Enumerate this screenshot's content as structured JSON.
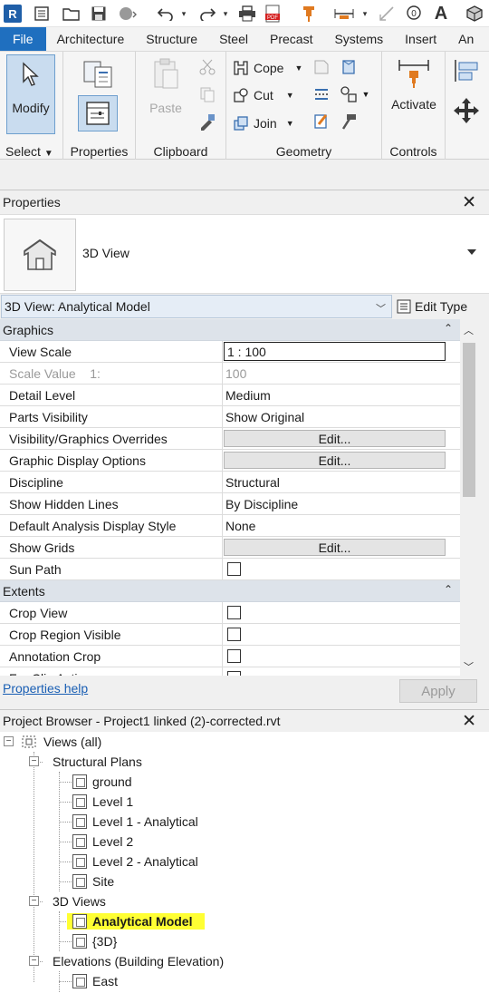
{
  "qat": {
    "icons": [
      "revit-logo",
      "open-icon",
      "save-icon",
      "sync-icon",
      "undo-icon",
      "redo-icon",
      "print-icon",
      "pdf-icon",
      "pin-icon",
      "measure-icon",
      "dimension-icon",
      "tag-icon",
      "text-icon",
      "3d-view-icon"
    ],
    "logo_letter": "R"
  },
  "tabs": [
    "File",
    "Architecture",
    "Structure",
    "Steel",
    "Precast",
    "Systems",
    "Insert",
    "An"
  ],
  "ribbon": {
    "modify_label": "Modify",
    "select_label": "Select",
    "properties_label": "Properties",
    "clipboard_label": "Clipboard",
    "paste_label": "Paste",
    "cope_label": "Cope",
    "cut_label": "Cut",
    "join_label": "Join",
    "geometry_label": "Geometry",
    "activate_label": "Activate",
    "controls_label": "Controls"
  },
  "properties": {
    "title": "Properties",
    "type_name": "3D View",
    "instance_selector": "3D View: Analytical Model",
    "edit_type": "Edit Type",
    "groups": {
      "graphics": "Graphics",
      "extents": "Extents"
    },
    "rows": {
      "view_scale": {
        "key": "View Scale",
        "value": "1 : 100"
      },
      "scale_value": {
        "key": "Scale Value    1:",
        "value": "100"
      },
      "detail_level": {
        "key": "Detail Level",
        "value": "Medium"
      },
      "parts_visibility": {
        "key": "Parts Visibility",
        "value": "Show Original"
      },
      "vg_overrides": {
        "key": "Visibility/Graphics Overrides",
        "value": "Edit..."
      },
      "graphic_display": {
        "key": "Graphic Display Options",
        "value": "Edit..."
      },
      "discipline": {
        "key": "Discipline",
        "value": "Structural"
      },
      "hidden_lines": {
        "key": "Show Hidden Lines",
        "value": "By Discipline"
      },
      "analysis_style": {
        "key": "Default Analysis Display Style",
        "value": "None"
      },
      "show_grids": {
        "key": "Show Grids",
        "value": "Edit..."
      },
      "sun_path": {
        "key": "Sun Path",
        "checked": false
      },
      "crop_view": {
        "key": "Crop View",
        "checked": false
      },
      "crop_region": {
        "key": "Crop Region Visible",
        "checked": false
      },
      "annotation_crop": {
        "key": "Annotation Crop",
        "checked": false
      },
      "far_clip": {
        "key": "Far Clip Active",
        "checked": false
      }
    },
    "help_link": "Properties help",
    "apply_label": "Apply"
  },
  "browser": {
    "title": "Project Browser - Project1 linked (2)-corrected.rvt",
    "views_all": "Views (all)",
    "structural_plans": "Structural Plans",
    "plans": [
      "ground",
      "Level 1",
      "Level 1 - Analytical",
      "Level 2",
      "Level 2 - Analytical",
      "Site"
    ],
    "views_3d": "3D Views",
    "views_3d_items": [
      "Analytical Model",
      "{3D}"
    ],
    "elevations": "Elevations (Building Elevation)",
    "elevation_items": [
      "East"
    ],
    "highlight_color": "#ffff33"
  }
}
